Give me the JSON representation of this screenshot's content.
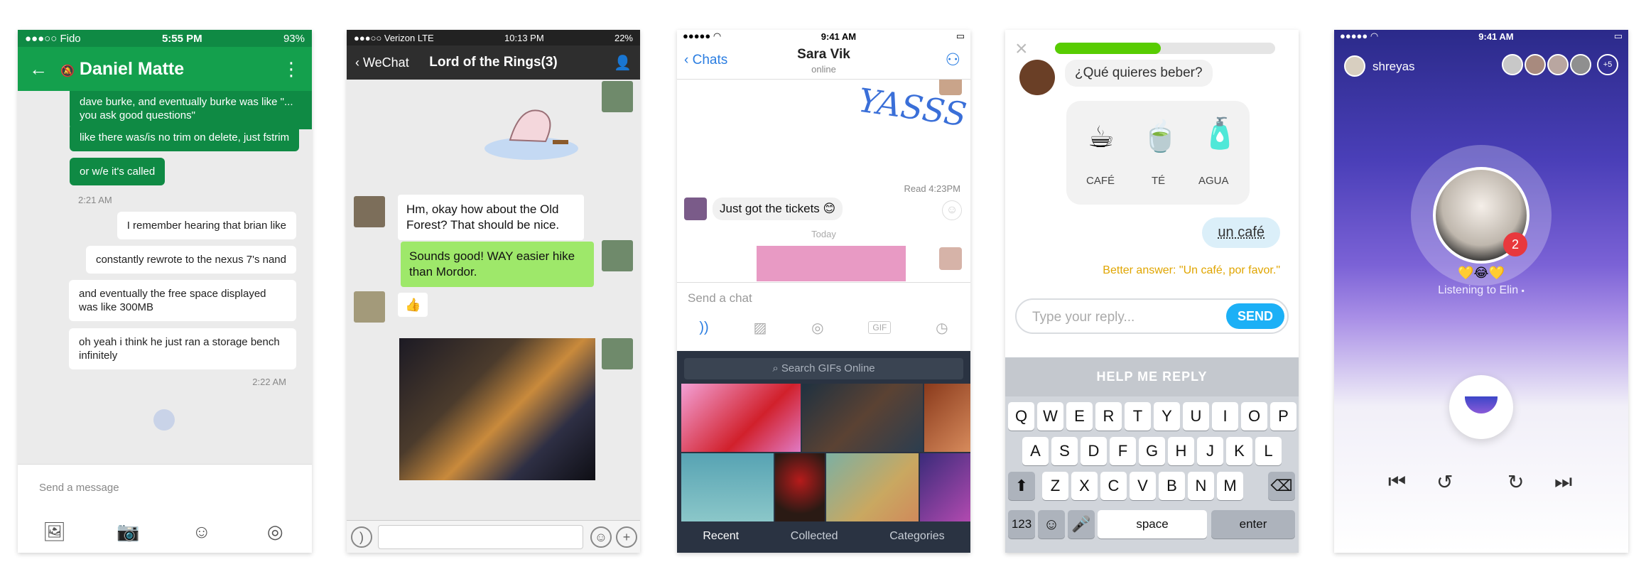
{
  "phones": {
    "hangouts": {
      "status": {
        "carrier": "●●●○○ Fido",
        "time": "5:55 PM",
        "battery": "93%"
      },
      "contact_name": "Daniel Matte",
      "messages": [
        {
          "text": "dave burke, and eventually burke was like \"... you ask good questions\""
        },
        {
          "text": "like there was/is no trim on delete, just fstrim"
        },
        {
          "text": "or w/e it's called"
        },
        {
          "text": "I remember hearing that brian like"
        },
        {
          "text": "constantly rewrote to the nexus 7's nand"
        },
        {
          "text": "and eventually the free space displayed was like 300MB"
        },
        {
          "text": "oh yeah i think he just ran a storage bench infinitely"
        }
      ],
      "timestamps": [
        "2:21 AM",
        "2:22 AM"
      ],
      "composer_placeholder": "Send a message"
    },
    "wechat": {
      "status": {
        "carrier": "●●●○○ Verizon  LTE",
        "time": "10:13 PM",
        "battery": "22%"
      },
      "back_label": "WeChat",
      "title": "Lord of the Rings(3)",
      "messages": [
        {
          "text": "Hm, okay how about the Old Forest? That should be nice."
        },
        {
          "text": "Sounds good! WAY easier hike than Mordor."
        },
        {
          "text": "👍"
        }
      ]
    },
    "kik": {
      "status": {
        "time": "9:41 AM"
      },
      "back_label": "Chats",
      "name": "Sara Vik",
      "presence": "online",
      "read_receipt": "Read 4:23PM",
      "message": "Just got the tickets 😊",
      "day_label": "Today",
      "sticker_text": "YASSS",
      "composer_placeholder": "Send a chat",
      "gif_search_placeholder": "Search GIFs Online",
      "tabs": [
        "Recent",
        "Collected",
        "Categories"
      ]
    },
    "duolingo": {
      "question": "¿Qué quieres beber?",
      "choices": [
        "CAFÉ",
        "TÉ",
        "AGUA"
      ],
      "answer": "un café",
      "feedback": "Better answer: \"Un café, por favor.\"",
      "reply_placeholder": "Type your reply...",
      "send_label": "SEND",
      "help_label": "HELP ME REPLY",
      "progress": 0.48,
      "keyboard": {
        "row1": [
          "Q",
          "W",
          "E",
          "R",
          "T",
          "Y",
          "U",
          "I",
          "O",
          "P"
        ],
        "row2": [
          "A",
          "S",
          "D",
          "F",
          "G",
          "H",
          "J",
          "K",
          "L"
        ],
        "row3": [
          "Z",
          "X",
          "C",
          "V",
          "B",
          "N",
          "M"
        ],
        "numbers_key": "123",
        "space_key": "space",
        "enter_key": "enter"
      }
    },
    "music": {
      "status": {
        "time": "9:41 AM"
      },
      "username": "shreyas",
      "listeners_extra": "+5",
      "badge_count": "2",
      "reactions": "💛😂💛",
      "listening_label": "Listening to Elin"
    }
  },
  "colors": {
    "hangouts_green": "#14a04d",
    "wechat_green": "#9ee86a",
    "kik_blue": "#2a7de1",
    "duolingo_blue": "#1cb0f6",
    "duolingo_progress": "#58cc02"
  }
}
